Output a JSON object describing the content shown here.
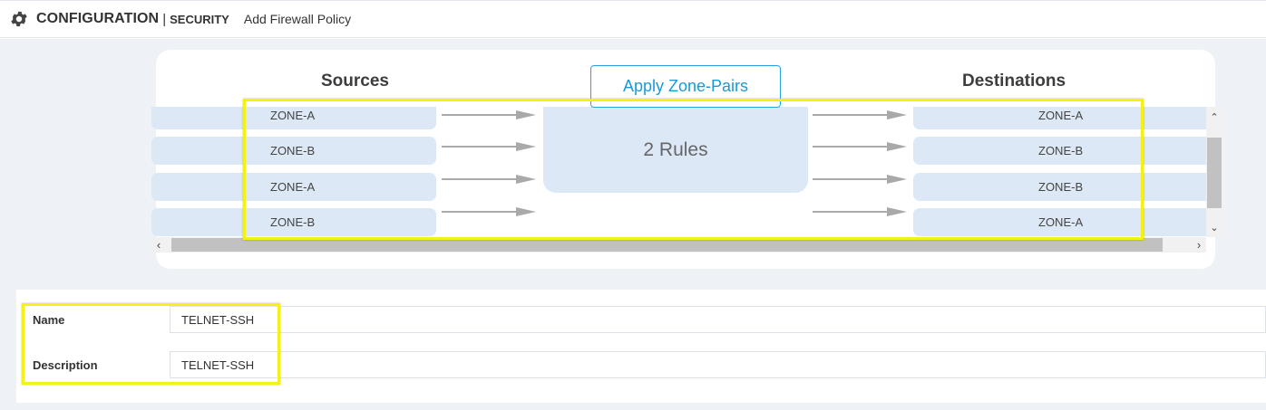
{
  "header": {
    "title": "CONFIGURATION",
    "separator": "|",
    "section": "SECURITY",
    "page": "Add Firewall Policy"
  },
  "zone_pairs": {
    "sources_title": "Sources",
    "destinations_title": "Destinations",
    "apply_button": "Apply Zone-Pairs",
    "rules_label": "2 Rules",
    "rows": [
      {
        "source": "ZONE-A",
        "destination": "ZONE-A"
      },
      {
        "source": "ZONE-B",
        "destination": "ZONE-B"
      },
      {
        "source": "ZONE-A",
        "destination": "ZONE-B"
      },
      {
        "source": "ZONE-B",
        "destination": "ZONE-A"
      }
    ]
  },
  "scrollbars": {
    "up_icon": "chevron-up",
    "down_icon": "chevron-down",
    "left_icon": "chevron-left",
    "right_icon": "chevron-right"
  },
  "form": {
    "name_label": "Name",
    "name_value": "TELNET-SSH",
    "description_label": "Description",
    "description_value": "TELNET-SSH"
  },
  "colors": {
    "accent": "#1a9ad6",
    "zone_fill": "#dce8f6",
    "highlight": "#f4f117",
    "page_bg": "#eef2f7"
  }
}
